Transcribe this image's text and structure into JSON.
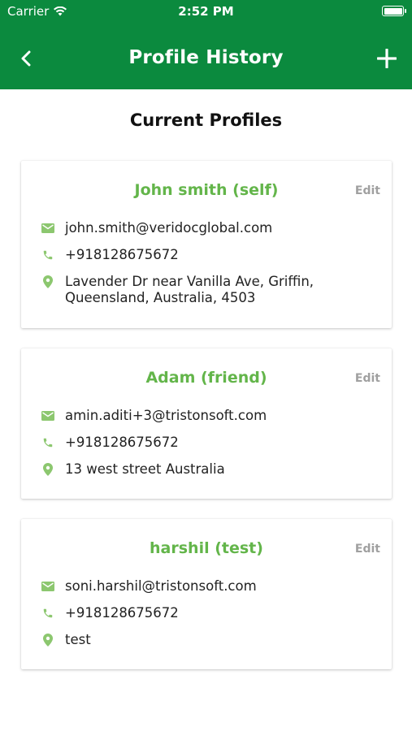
{
  "status_bar": {
    "carrier": "Carrier",
    "time": "2:52 PM"
  },
  "nav": {
    "title": "Profile History",
    "back_icon": "chevron-left-icon",
    "add_icon": "plus-icon"
  },
  "section_title": "Current Profiles",
  "colors": {
    "primary": "#0b8a3e",
    "accent": "#63b54a",
    "icon": "#8cc76f",
    "muted": "#a0a0a0"
  },
  "profiles": [
    {
      "name": "John smith (self)",
      "edit_label": "Edit",
      "email": "john.smith@veridocglobal.com",
      "phone": "+918128675672",
      "address": "Lavender Dr near Vanilla Ave, Griffin, Queensland, Australia, 4503"
    },
    {
      "name": "Adam (friend)",
      "edit_label": "Edit",
      "email": "amin.aditi+3@tristonsoft.com",
      "phone": "+918128675672",
      "address": "13 west street Australia"
    },
    {
      "name": "harshil (test)",
      "edit_label": "Edit",
      "email": "soni.harshil@tristonsoft.com",
      "phone": "+918128675672",
      "address": "test"
    }
  ]
}
